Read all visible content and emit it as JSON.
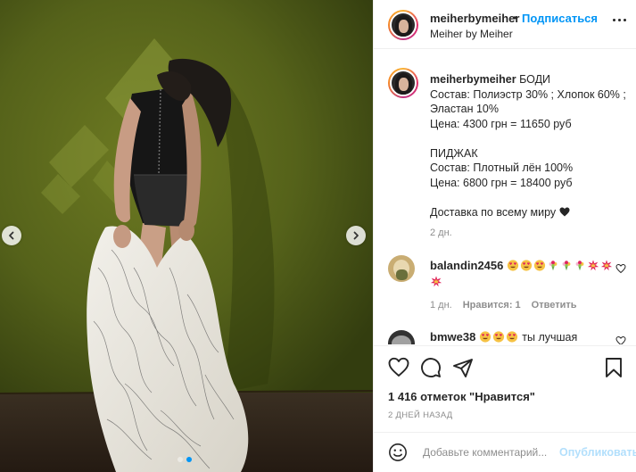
{
  "header": {
    "username": "meiherbymeiher",
    "separator": "•",
    "follow_label": "Подписаться",
    "subtitle": "Meiher by Meiher"
  },
  "caption": {
    "username": "meiherbymeiher",
    "line1": "БОДИ",
    "line2": "Состав: Полиэстр 30% ; Хлопок 60% ;",
    "line3": "Эластан 10%",
    "line4": "Цена: 4300 грн = 11650 руб",
    "line5": "ПИДЖАК",
    "line6": "Состав: Плотный лён 100%",
    "line7": "Цена: 6800 грн = 18400 руб",
    "line8": "Доставка по всему миру",
    "time": "2 дн."
  },
  "comments": [
    {
      "username": "balandin2456",
      "emoji": [
        "smiling-face-with-heart-eyes",
        "smiling-face-with-heart-eyes",
        "smiling-face-with-heart-eyes",
        "bouquet",
        "bouquet",
        "bouquet",
        "collision",
        "collision",
        "collision"
      ],
      "time": "1 дн.",
      "likes": "Нравится: 1",
      "reply": "Ответить"
    },
    {
      "username": "bmwe38",
      "emoji": [
        "smiling-face-with-heart-eyes",
        "smiling-face-with-heart-eyes",
        "smiling-face-with-heart-eyes"
      ],
      "text": "ты лучшая"
    }
  ],
  "actions": {
    "likes_text": "1 416 отметок \"Нравится\"",
    "date": "2 ДНЕЙ НАЗАД",
    "comment_placeholder": "Добавьте комментарий...",
    "publish_label": "Опубликовать"
  },
  "carousel": {
    "slides": 2,
    "active_index": 1
  },
  "colors": {
    "accent": "#0095f6",
    "publish_disabled": "#b2dffc",
    "muted": "#8e8e8e",
    "text": "#262626"
  }
}
